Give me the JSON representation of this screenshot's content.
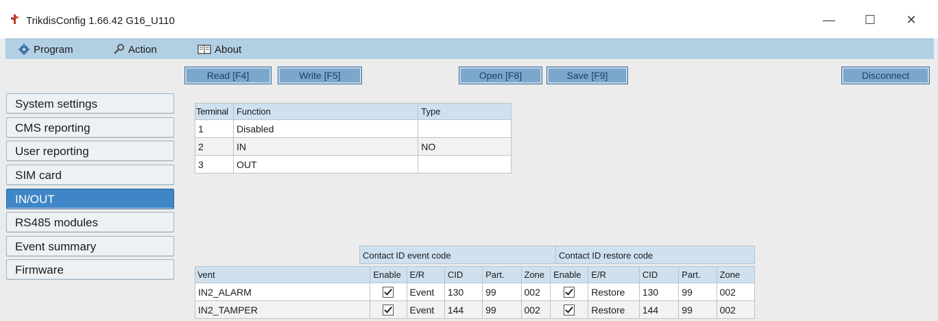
{
  "window": {
    "title": "TrikdisConfig 1.66.42   G16_U110",
    "minimize": "—",
    "maximize": "☐",
    "close": "✕"
  },
  "menu": {
    "program": "Program",
    "action": "Action",
    "about": "About"
  },
  "toolbar": {
    "read": "Read [F4]",
    "write": "Write [F5]",
    "open": "Open [F8]",
    "save": "Save [F9]",
    "disconnect": "Disconnect"
  },
  "sidebar": {
    "items": [
      {
        "label": "System settings"
      },
      {
        "label": "CMS reporting"
      },
      {
        "label": "User reporting"
      },
      {
        "label": "SIM card"
      },
      {
        "label": "IN/OUT"
      },
      {
        "label": "RS485 modules"
      },
      {
        "label": "Event summary"
      },
      {
        "label": "Firmware"
      }
    ],
    "active": "IN/OUT"
  },
  "terminals": {
    "headers": [
      "Terminal",
      "Function",
      "Type"
    ],
    "rows": [
      {
        "terminal": "1",
        "function": "Disabled",
        "type": ""
      },
      {
        "terminal": "2",
        "function": "IN",
        "type": "NO"
      },
      {
        "terminal": "3",
        "function": "OUT",
        "type": ""
      }
    ]
  },
  "events": {
    "group_event": "Contact ID event code",
    "group_restore": "Contact ID restore code",
    "headers": [
      "Event",
      "Enable",
      "E/R",
      "CID",
      "Part.",
      "Zone",
      "Enable",
      "E/R",
      "CID",
      "Part.",
      "Zone"
    ],
    "event_header_display": "̓vent",
    "rows": [
      {
        "event": "IN2_ALARM",
        "enable": true,
        "er": "Event",
        "cid": "130",
        "part": "99",
        "zone": "002",
        "r_enable": true,
        "r_er": "Restore",
        "r_cid": "130",
        "r_part": "99",
        "r_zone": "002"
      },
      {
        "event": "IN2_TAMPER",
        "enable": true,
        "er": "Event",
        "cid": "144",
        "part": "99",
        "zone": "002",
        "r_enable": true,
        "r_er": "Restore",
        "r_cid": "144",
        "r_part": "99",
        "r_zone": "002"
      }
    ]
  },
  "colors": {
    "menubar": "#b2cfe4",
    "button": "#7ca7cd",
    "active_item": "#3f86c6",
    "table_header": "#cfe0ee"
  }
}
